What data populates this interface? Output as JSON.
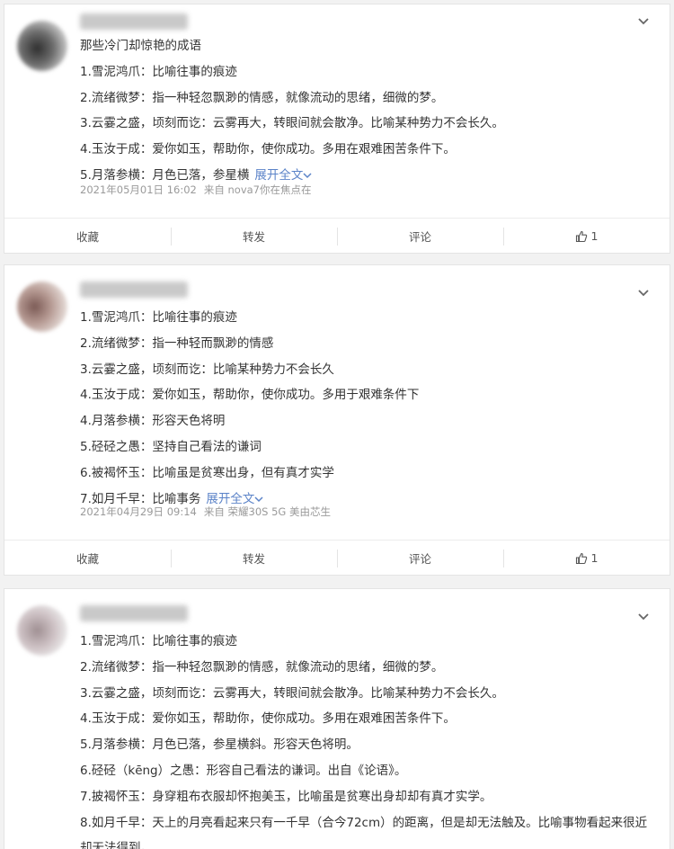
{
  "cards": [
    {
      "lines": [
        "那些冷门却惊艳的成语",
        "1.雪泥鸿爪：比喻往事的痕迹",
        "2.流绪微梦：指一种轻忽飘渺的情感，就像流动的思绪，细微的梦。",
        "3.云霎之盛，顷刻而讫：云雾再大，转眼间就会散净。比喻某种势力不会长久。",
        "4.玉汝于成：爱你如玉，帮助你，使你成功。多用在艰难困苦条件下。",
        "5.月落参横：月色已落，参星横"
      ],
      "expand": "展开全文",
      "date": "2021年05月01日 16:02",
      "source": "来自 nova7你在焦点在",
      "actions": {
        "collect": "收藏",
        "repost": "转发",
        "comment": "评论",
        "like": "1"
      }
    },
    {
      "lines": [
        "1.雪泥鸿爪：比喻往事的痕迹",
        "2.流绪微梦：指一种轻而飘渺的情感",
        "3.云霎之盛，顷刻而讫：比喻某种势力不会长久",
        "4.玉汝于成：爱你如玉，帮助你，使你成功。多用于艰难条件下",
        "4.月落参横：形容天色将明",
        "5.硁硁之愚：坚持自己看法的谦词",
        "6.被褐怀玉：比喻虽是贫寒出身，但有真才实学",
        "7.如月千早：比喻事务"
      ],
      "expand": "展开全文",
      "date": "2021年04月29日 09:14",
      "source": "来自 荣耀30S 5G 美由芯生",
      "actions": {
        "collect": "收藏",
        "repost": "转发",
        "comment": "评论",
        "like": "1"
      }
    },
    {
      "lines": [
        "1.雪泥鸿爪：比喻往事的痕迹",
        "2.流绪微梦：指一种轻忽飘渺的情感，就像流动的思绪，细微的梦。",
        "3.云霎之盛，顷刻而讫：云雾再大，转眼间就会散净。比喻某种势力不会长久。",
        "4.玉汝于成：爱你如玉，帮助你，使你成功。多用在艰难困苦条件下。",
        "5.月落参横：月色已落，参星横斜。形容天色将明。",
        "6.硁硁（kēng）之愚：形容自己看法的谦词。出自《论语》。",
        "7.披褐怀玉：身穿粗布衣服却怀抱美玉，比喻虽是贫寒出身却却有真才实学。",
        "8.如月千早：天上的月亮看起来只有一千早（合今72cm）的距离，但是却无法触及。比喻事物看起来很近却无法得到。"
      ]
    }
  ]
}
